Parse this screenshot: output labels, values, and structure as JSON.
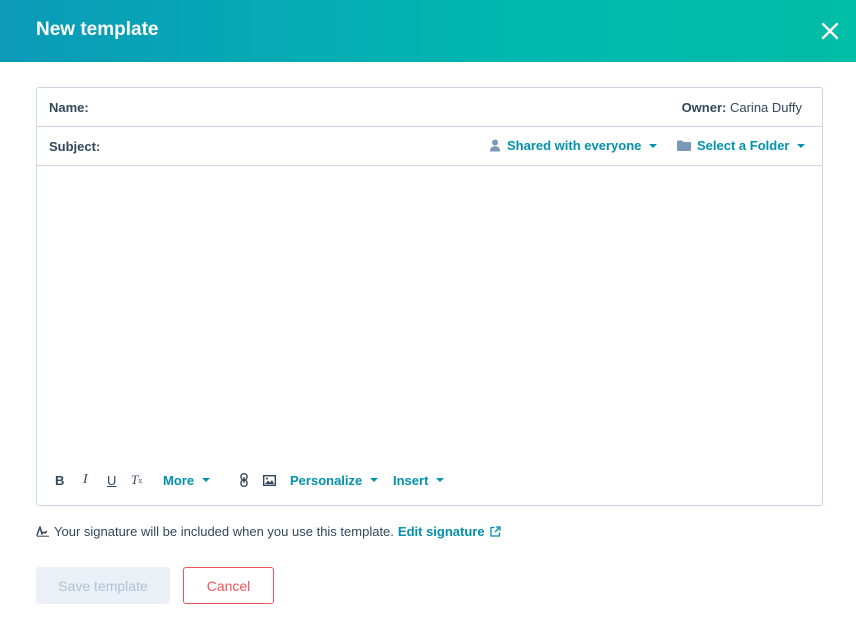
{
  "header": {
    "title": "New template"
  },
  "fields": {
    "name_label": "Name:",
    "name_value": "",
    "owner_label": "Owner:",
    "owner_value": "Carina Duffy",
    "subject_label": "Subject:",
    "subject_value": "",
    "body_value": ""
  },
  "dropdowns": {
    "share_label": "Shared with everyone",
    "folder_label": "Select a Folder"
  },
  "toolbar": {
    "bold": "B",
    "italic": "I",
    "underline": "U",
    "clear_format": "T",
    "clear_format_sub": "x",
    "more": "More",
    "personalize": "Personalize",
    "insert": "Insert"
  },
  "signature": {
    "note": "Your signature will be included when you use this template.",
    "edit_link": "Edit signature"
  },
  "buttons": {
    "save": "Save template",
    "cancel": "Cancel"
  },
  "colors": {
    "accent": "#0091ae",
    "danger": "#f2545b",
    "header_start": "#0b9ab8",
    "header_end": "#00bda5",
    "border": "#cbd6e2"
  },
  "icons": {
    "close": "close-icon",
    "share": "person-icon",
    "folder": "folder-icon",
    "link": "link-icon",
    "image": "image-icon",
    "signature": "signature-icon",
    "external": "external-link-icon"
  }
}
